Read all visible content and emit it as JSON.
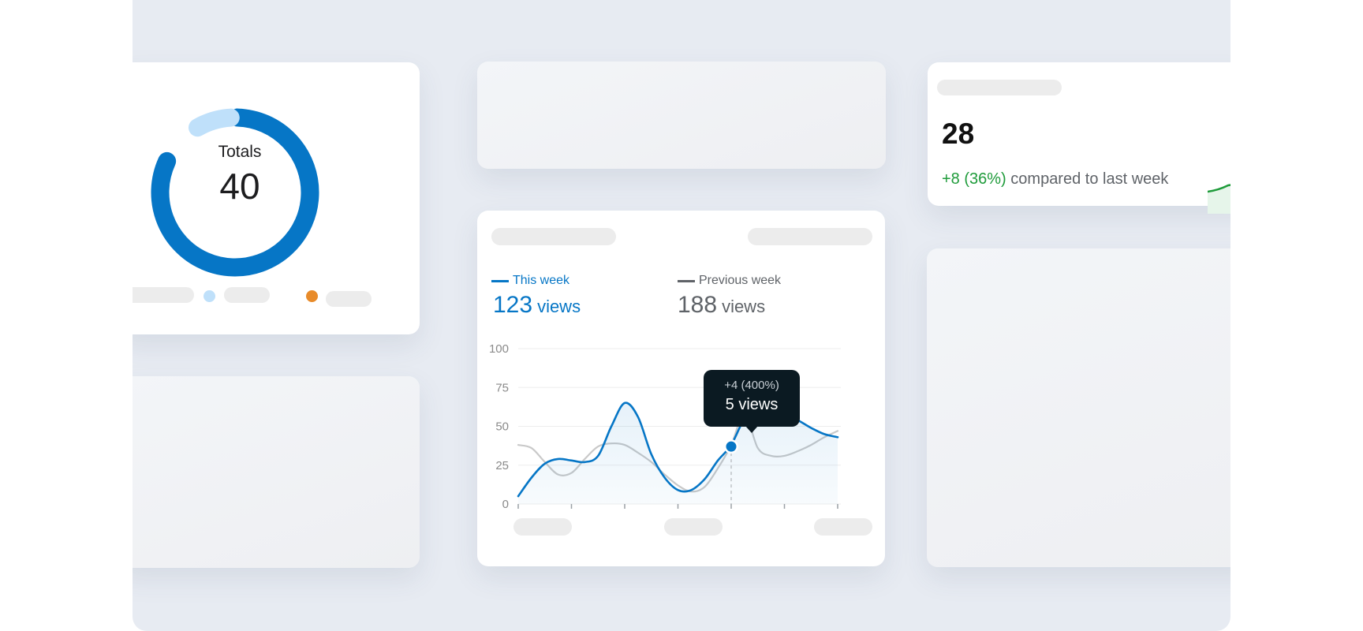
{
  "colors": {
    "accent": "#0676c6",
    "accent_light": "#bfe0fa",
    "orange": "#e88b2a",
    "previous": "#c9c9c9",
    "positive": "#1e9b3a"
  },
  "donut_card": {
    "title": "Totals",
    "total": "40",
    "legend_dot_colors": [
      "#bfe0fa",
      "#e88b2a"
    ]
  },
  "views_card": {
    "this_week": {
      "label": "This week",
      "value": "123",
      "unit": "views"
    },
    "previous_week": {
      "label": "Previous week",
      "value": "188",
      "unit": "views"
    },
    "tooltip": {
      "delta": "+4 (400%)",
      "value": "5 views"
    }
  },
  "stat_card": {
    "value": "28",
    "delta": "+8 (36%)",
    "compare_text": "compared to last week"
  },
  "chart_data": {
    "type": "line",
    "x": [
      0,
      0.25,
      0.5,
      0.75,
      1,
      1.25,
      1.5,
      1.75,
      2,
      2.25,
      2.5,
      2.75,
      3,
      3.25,
      3.5,
      3.75,
      4,
      4.25,
      4.5,
      4.75,
      5,
      5.25,
      5.5,
      5.75,
      6
    ],
    "ylim": [
      0,
      100
    ],
    "yticks": [
      0,
      25,
      50,
      75,
      100
    ],
    "xticks": [
      0,
      1,
      2,
      3,
      4,
      5,
      6
    ],
    "grid": true,
    "legend": "top-left",
    "series": [
      {
        "name": "This week",
        "color": "#0676c6",
        "fill": true,
        "values": [
          5,
          17,
          26,
          29,
          28,
          27,
          31,
          50,
          65,
          56,
          32,
          17,
          9,
          9,
          16,
          28,
          38,
          55,
          62,
          61,
          58,
          54,
          49,
          45,
          43
        ]
      },
      {
        "name": "Previous week",
        "color": "#c9c9c9",
        "fill": false,
        "values": [
          38,
          36,
          27,
          19,
          20,
          29,
          37,
          39,
          38,
          33,
          27,
          19,
          12,
          8,
          11,
          23,
          38,
          58,
          36,
          31,
          31,
          34,
          38,
          43,
          47
        ]
      }
    ],
    "highlight": {
      "x": 4,
      "y": 37
    }
  }
}
